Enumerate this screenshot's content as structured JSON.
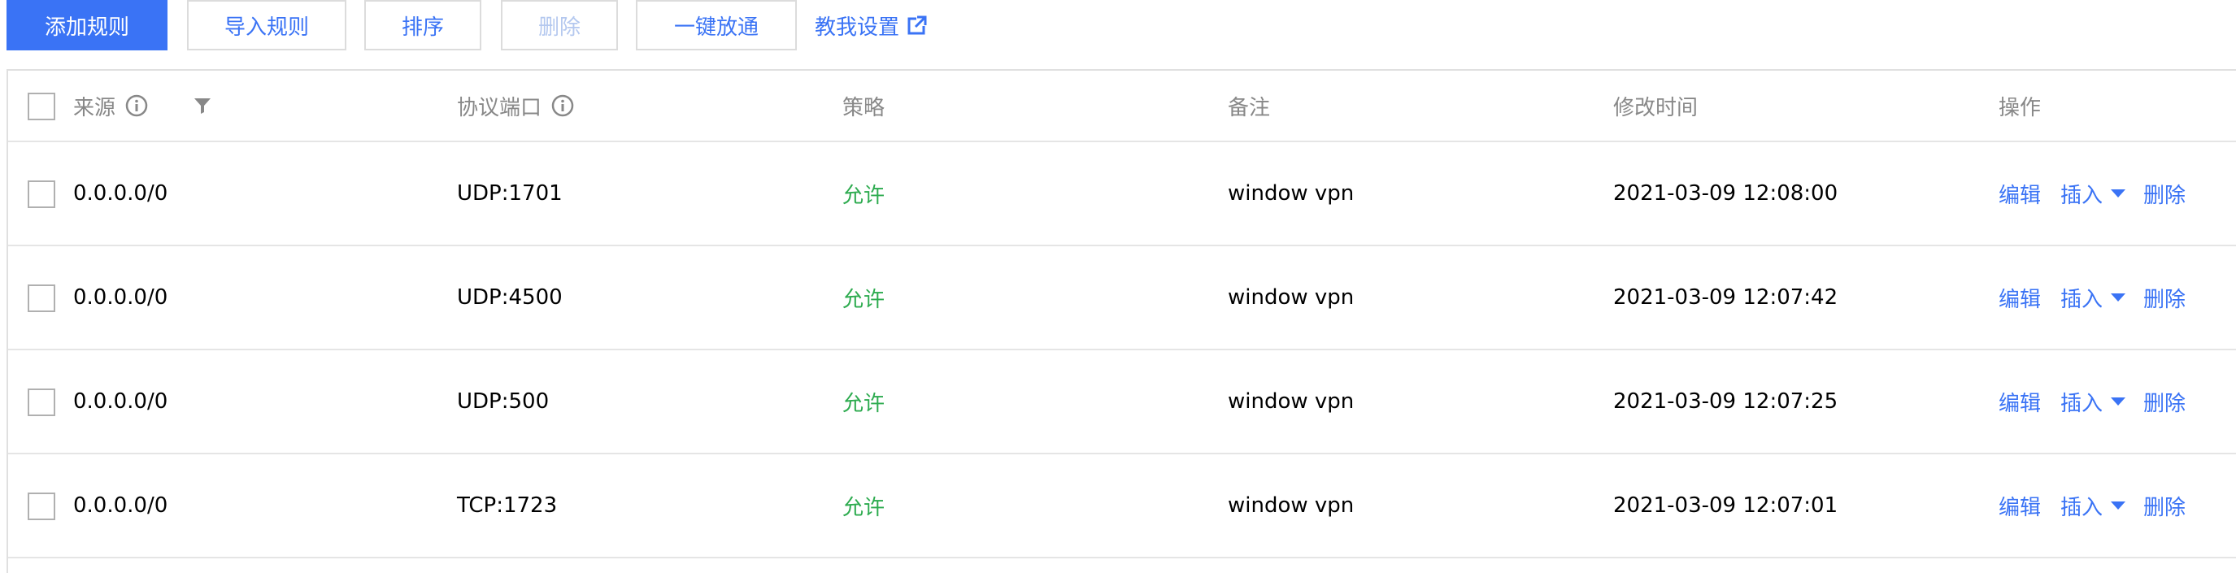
{
  "toolbar": {
    "add_rule": "添加规则",
    "import_rule": "导入规则",
    "sort": "排序",
    "delete": "删除",
    "open_all": "一键放通",
    "guide": "教我设置"
  },
  "table": {
    "columns": {
      "source": "来源",
      "protocol_port": "协议端口",
      "policy": "策略",
      "remark": "备注",
      "modified": "修改时间",
      "actions": "操作"
    },
    "row_actions": {
      "edit": "编辑",
      "insert": "插入",
      "delete": "删除"
    },
    "rows": [
      {
        "source": "0.0.0.0/0",
        "protocol_port": "UDP:1701",
        "policy": "允许",
        "remark": "window vpn",
        "modified": "2021-03-09 12:08:00"
      },
      {
        "source": "0.0.0.0/0",
        "protocol_port": "UDP:4500",
        "policy": "允许",
        "remark": "window vpn",
        "modified": "2021-03-09 12:07:42"
      },
      {
        "source": "0.0.0.0/0",
        "protocol_port": "UDP:500",
        "policy": "允许",
        "remark": "window vpn",
        "modified": "2021-03-09 12:07:25"
      },
      {
        "source": "0.0.0.0/0",
        "protocol_port": "TCP:1723",
        "policy": "允许",
        "remark": "window vpn",
        "modified": "2021-03-09 12:07:01"
      }
    ]
  },
  "icons": {
    "info": "info-icon",
    "filter": "filter-icon",
    "external_link": "external-link-icon",
    "caret_down": "caret-down-icon"
  },
  "colors": {
    "primary": "#3a73f5",
    "allow": "#2dab4f",
    "disabled": "#b4c8ef",
    "header_text": "#888888",
    "border": "#e5e5e5"
  }
}
